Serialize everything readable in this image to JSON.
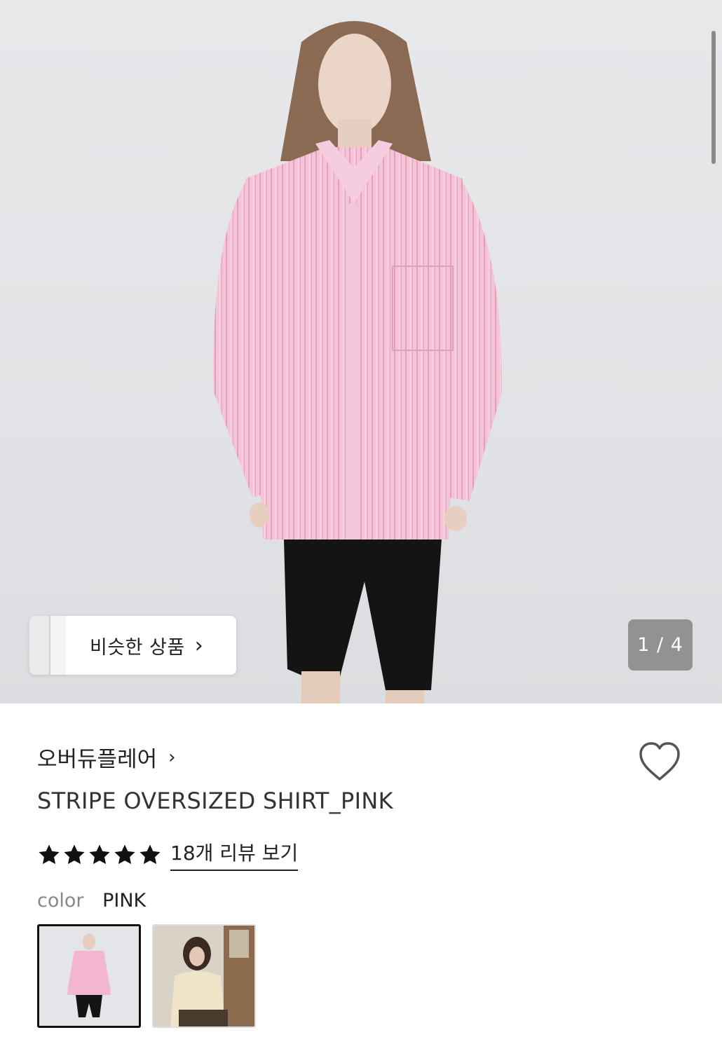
{
  "gallery": {
    "current_slide": 1,
    "total_slides": 4,
    "counter_text": "1 / 4",
    "similar_label": "비슷한 상품",
    "similar_chevron": "›"
  },
  "product": {
    "brand": "오버듀플레어",
    "brand_chevron": "›",
    "name": "STRIPE OVERSIZED SHIRT_PINK",
    "rating": 5,
    "rating_max": 5,
    "review_link": "18개 리뷰 보기",
    "color_label": "color",
    "color_value": "PINK"
  },
  "icons": {
    "wishlist": "heart-outline-icon",
    "star": "star-filled-icon",
    "chevron": "chevron-right-icon"
  },
  "colors": {
    "text": "#222222",
    "muted": "#888888",
    "shirt_pink": "#f2b7cf",
    "counter_bg": "#7f7f7f"
  }
}
